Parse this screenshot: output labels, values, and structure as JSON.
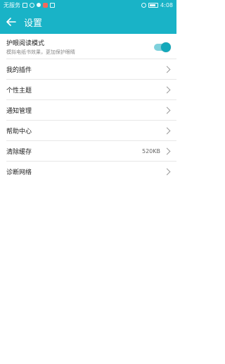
{
  "status_bar": {
    "carrier": "无服务",
    "time": "4:08"
  },
  "app_bar": {
    "title": "设置"
  },
  "items": [
    {
      "label": "护眼阅读模式",
      "sub": "模拟电纸书效果，更加保护眼睛",
      "toggle_on": true
    },
    {
      "label": "我的插件"
    },
    {
      "label": "个性主题"
    },
    {
      "label": "通知管理"
    },
    {
      "label": "帮助中心"
    },
    {
      "label": "清除缓存",
      "value": "520KB"
    },
    {
      "label": "诊断网络"
    }
  ],
  "colors": {
    "accent": "#19b3c7",
    "toggle_knob": "#14a8ba"
  },
  "icons": [
    "back-arrow-icon",
    "chevron-right-icon"
  ]
}
